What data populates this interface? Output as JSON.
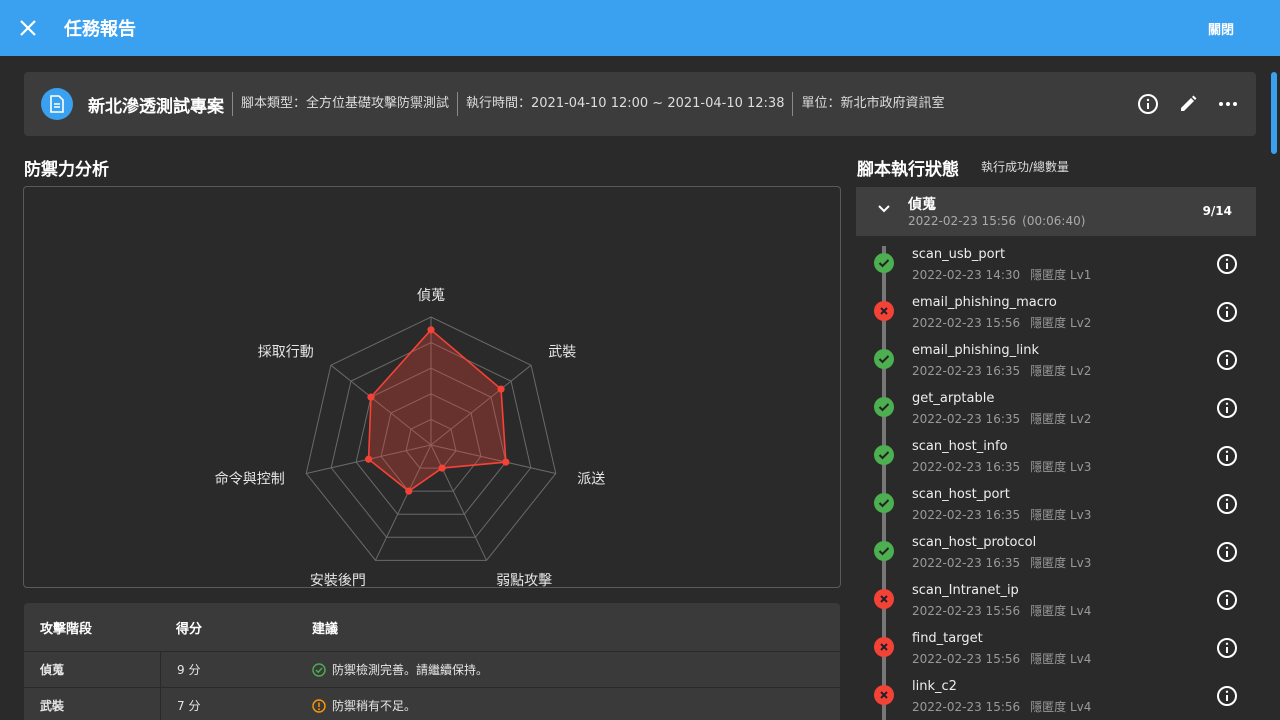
{
  "app": {
    "title": "任務報告",
    "close_label": "關閉"
  },
  "header": {
    "project_name": "新北滲透測試專案",
    "script_type": "腳本類型：全方位基礎攻擊防禦測試",
    "exec_time": "執行時間：2021-04-10 12:00 ~ 2021-04-10 12:38",
    "unit": "單位：新北市政府資訊室"
  },
  "defense": {
    "title": "防禦力分析",
    "table": {
      "headers": [
        "攻擊階段",
        "得分",
        "建議"
      ],
      "rows": [
        {
          "stage": "偵蒐",
          "score": "9 分",
          "advice": "防禦檢測完善。請繼續保持。",
          "status": "ok"
        },
        {
          "stage": "武裝",
          "score": "7 分",
          "advice": "防禦稍有不足。",
          "status": "warn"
        }
      ]
    }
  },
  "chart_data": {
    "type": "radar",
    "categories": [
      "偵蒐",
      "武裝",
      "派送",
      "弱點攻擊",
      "安裝後門",
      "命令與控制",
      "採取行動"
    ],
    "values": [
      9,
      7,
      6,
      2,
      4,
      5,
      6
    ],
    "rlim": [
      0,
      10
    ],
    "grid": true,
    "series_color": "#f44336"
  },
  "script_status": {
    "title": "腳本執行狀態",
    "subtitle": "執行成功/總數量",
    "group": {
      "name": "偵蒐",
      "time": "2022-02-23 15:56",
      "duration": "(00:06:40)",
      "count": "9/14"
    },
    "tasks": [
      {
        "name": "scan_usb_port",
        "time": "2022-02-23 14:30",
        "level": "隱匿度 Lv1",
        "status": "ok"
      },
      {
        "name": "email_phishing_macro",
        "time": "2022-02-23 15:56",
        "level": "隱匿度 Lv2",
        "status": "fail"
      },
      {
        "name": "email_phishing_link",
        "time": "2022-02-23 16:35",
        "level": "隱匿度 Lv2",
        "status": "ok"
      },
      {
        "name": "get_arptable",
        "time": "2022-02-23 16:35",
        "level": "隱匿度 Lv2",
        "status": "ok"
      },
      {
        "name": "scan_host_info",
        "time": "2022-02-23 16:35",
        "level": "隱匿度 Lv3",
        "status": "ok"
      },
      {
        "name": "scan_host_port",
        "time": "2022-02-23 16:35",
        "level": "隱匿度 Lv3",
        "status": "ok"
      },
      {
        "name": "scan_host_protocol",
        "time": "2022-02-23 16:35",
        "level": "隱匿度 Lv3",
        "status": "ok"
      },
      {
        "name": "scan_Intranet_ip",
        "time": "2022-02-23 15:56",
        "level": "隱匿度 Lv4",
        "status": "fail"
      },
      {
        "name": "find_target",
        "time": "2022-02-23 15:56",
        "level": "隱匿度 Lv4",
        "status": "fail"
      },
      {
        "name": "link_c2",
        "time": "2022-02-23 15:56",
        "level": "隱匿度 Lv4",
        "status": "fail"
      }
    ]
  },
  "colors": {
    "accent": "#3aa0f0",
    "ok": "#4caf50",
    "fail": "#f44336",
    "warn": "#ff9800"
  }
}
